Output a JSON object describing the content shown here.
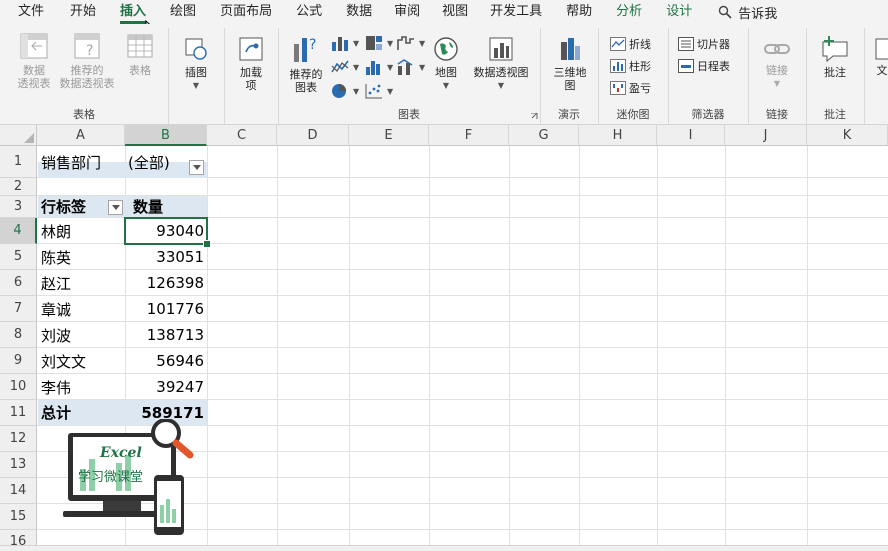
{
  "ribbon_tabs": [
    "文件",
    "开始",
    "插入",
    "绘图",
    "页面布局",
    "公式",
    "数据",
    "审阅",
    "视图",
    "开发工具",
    "帮助",
    "分析",
    "设计"
  ],
  "tell_me": "告诉我",
  "groups": {
    "tables": {
      "label": "表格",
      "pivot_table": "数据\n透视表",
      "recommended_pivot": "推荐的\n数据透视表",
      "table": "表格"
    },
    "illustrations": {
      "label": "插图"
    },
    "addins": {
      "label": "加载\n项"
    },
    "charts": {
      "label": "图表",
      "recommended_charts": "推荐的\n图表",
      "maps": "地图",
      "pivot_chart": "数据透视图"
    },
    "tours": {
      "label": "演示",
      "map3d": "三维地\n图"
    },
    "sparklines": {
      "label": "迷你图",
      "line": "折线",
      "column": "柱形",
      "win_loss": "盈亏"
    },
    "filters": {
      "label": "筛选器",
      "slicer": "切片器",
      "timeline": "日程表"
    },
    "links": {
      "label": "链接",
      "link": "链接"
    },
    "comments": {
      "label": "批注",
      "comment": "批注"
    },
    "text": {
      "partial": "文"
    }
  },
  "columns": [
    "A",
    "B",
    "C",
    "D",
    "E",
    "F",
    "G",
    "H",
    "I",
    "J",
    "K"
  ],
  "rows": [
    "1",
    "2",
    "3",
    "4",
    "5",
    "6",
    "7",
    "8",
    "9",
    "10",
    "11",
    "12",
    "13",
    "14",
    "15",
    "16"
  ],
  "pivot": {
    "filter_label": "销售部门",
    "filter_value": "(全部)",
    "row_label_header": "行标签",
    "value_header": "数量",
    "entries": [
      {
        "name": "林朗",
        "value": "93040"
      },
      {
        "name": "陈英",
        "value": "33051"
      },
      {
        "name": "赵江",
        "value": "126398"
      },
      {
        "name": "章诚",
        "value": "101776"
      },
      {
        "name": "刘波",
        "value": "138713"
      },
      {
        "name": "刘文文",
        "value": "56946"
      },
      {
        "name": "李伟",
        "value": "39247"
      }
    ],
    "total_label": "总计",
    "total_value": "589171"
  },
  "logo": {
    "title": "Excel",
    "subtitle": "学习微课堂"
  },
  "colors": {
    "accent": "#217346",
    "band": "#dde7f2"
  }
}
